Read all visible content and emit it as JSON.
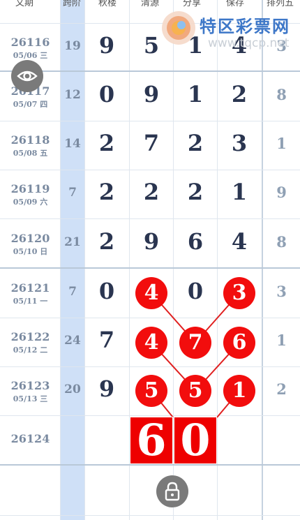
{
  "header": [
    "文期",
    "跨阶",
    "秋楼",
    "清源",
    "分享",
    "保存",
    "排列五"
  ],
  "logo": {
    "text": "特区彩票网",
    "url": "www.tqcp.net"
  },
  "rows": [
    {
      "period": "26116",
      "date": "05/06 三",
      "span": "19",
      "digits": [
        "9",
        "5",
        "1",
        "4"
      ],
      "last": "3"
    },
    {
      "period": "26117",
      "date": "05/07 四",
      "span": "12",
      "digits": [
        "0",
        "9",
        "1",
        "2"
      ],
      "last": "8"
    },
    {
      "period": "26118",
      "date": "05/08 五",
      "span": "14",
      "digits": [
        "2",
        "7",
        "2",
        "3"
      ],
      "last": "1"
    },
    {
      "period": "26119",
      "date": "05/09 六",
      "span": "7",
      "digits": [
        "2",
        "2",
        "2",
        "1"
      ],
      "last": "9"
    },
    {
      "period": "26120",
      "date": "05/10 日",
      "span": "21",
      "digits": [
        "2",
        "9",
        "6",
        "4"
      ],
      "last": "8"
    },
    {
      "period": "26121",
      "date": "05/11 一",
      "span": "7",
      "digits": [
        "0",
        "4",
        "0",
        "3"
      ],
      "last": "3"
    },
    {
      "period": "26122",
      "date": "05/12 二",
      "span": "24",
      "digits": [
        "7",
        "4",
        "7",
        "6"
      ],
      "last": "1"
    },
    {
      "period": "26123",
      "date": "05/13 三",
      "span": "20",
      "digits": [
        "9",
        "5",
        "5",
        "1"
      ],
      "last": "2"
    },
    {
      "period": "26124",
      "date": "",
      "span": "",
      "digits": [
        "",
        "",
        "",
        ""
      ],
      "last": ""
    }
  ],
  "prediction": [
    "6",
    "0"
  ],
  "icons": {
    "view": "eye-icon",
    "lock": "lock-icon"
  },
  "colors": {
    "accent": "#f20d0d",
    "column_highlight": "#cfe0f7",
    "text": "#2a3550"
  }
}
